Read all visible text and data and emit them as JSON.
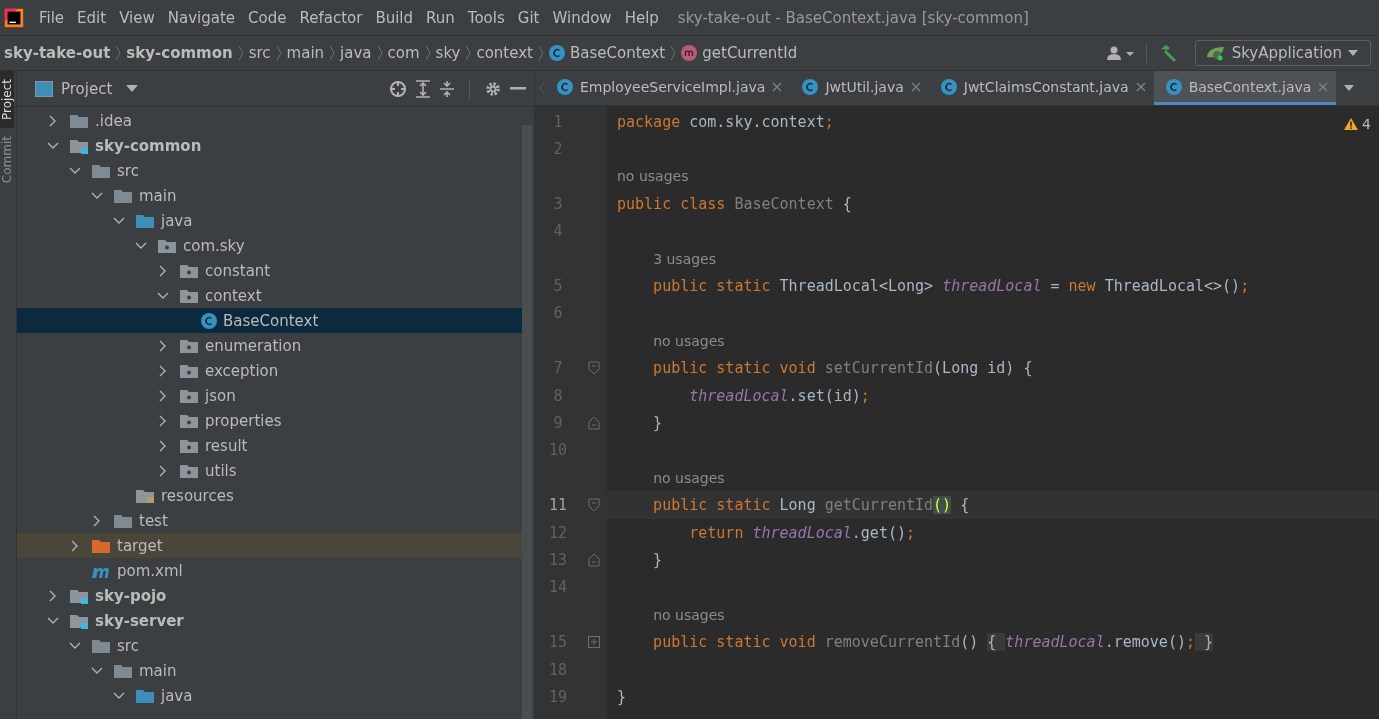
{
  "menu": [
    "File",
    "Edit",
    "View",
    "Navigate",
    "Code",
    "Refactor",
    "Build",
    "Run",
    "Tools",
    "Git",
    "Window",
    "Help"
  ],
  "window_title": "sky-take-out - BaseContext.java [sky-common]",
  "breadcrumbs": [
    {
      "text": "sky-take-out",
      "kind": "module"
    },
    {
      "text": "sky-common",
      "kind": "module"
    },
    {
      "text": "src",
      "kind": "folder"
    },
    {
      "text": "main",
      "kind": "folder"
    },
    {
      "text": "java",
      "kind": "folder"
    },
    {
      "text": "com",
      "kind": "folder"
    },
    {
      "text": "sky",
      "kind": "folder"
    },
    {
      "text": "context",
      "kind": "folder"
    },
    {
      "text": "BaseContext",
      "kind": "class"
    },
    {
      "text": "getCurrentId",
      "kind": "method"
    }
  ],
  "run_config": "SkyApplication",
  "side_tabs": [
    {
      "label": "Project",
      "selected": true
    },
    {
      "label": "Commit",
      "selected": false
    }
  ],
  "project_panel": {
    "title": "Project",
    "tree": [
      {
        "label": ".idea",
        "kind": "folder",
        "expanded": false,
        "selected": false
      },
      {
        "label": "sky-common",
        "kind": "module",
        "expanded": true,
        "selected": false,
        "children": [
          {
            "label": "src",
            "kind": "folder",
            "expanded": true,
            "selected": false,
            "children": [
              {
                "label": "main",
                "kind": "folder",
                "expanded": true,
                "selected": false,
                "children": [
                  {
                    "label": "java",
                    "kind": "source",
                    "expanded": true,
                    "selected": false,
                    "children": [
                      {
                        "label": "com.sky",
                        "kind": "package",
                        "expanded": true,
                        "selected": false,
                        "children": [
                          {
                            "label": "constant",
                            "kind": "package",
                            "expanded": false,
                            "selected": false
                          },
                          {
                            "label": "context",
                            "kind": "package",
                            "expanded": true,
                            "selected": false,
                            "children": [
                              {
                                "label": "BaseContext",
                                "kind": "class",
                                "selected": true
                              }
                            ]
                          },
                          {
                            "label": "enumeration",
                            "kind": "package",
                            "expanded": false,
                            "selected": false
                          },
                          {
                            "label": "exception",
                            "kind": "package",
                            "expanded": false,
                            "selected": false
                          },
                          {
                            "label": "json",
                            "kind": "package",
                            "expanded": false,
                            "selected": false
                          },
                          {
                            "label": "properties",
                            "kind": "package",
                            "expanded": false,
                            "selected": false
                          },
                          {
                            "label": "result",
                            "kind": "package",
                            "expanded": false,
                            "selected": false
                          },
                          {
                            "label": "utils",
                            "kind": "package",
                            "expanded": false,
                            "selected": false
                          }
                        ]
                      }
                    ]
                  },
                  {
                    "label": "resources",
                    "kind": "resources",
                    "selected": false
                  }
                ]
              },
              {
                "label": "test",
                "kind": "folder",
                "expanded": false,
                "selected": false
              }
            ]
          },
          {
            "label": "target",
            "kind": "excluded",
            "expanded": false,
            "selected": false
          },
          {
            "label": "pom.xml",
            "kind": "maven",
            "selected": false
          }
        ]
      },
      {
        "label": "sky-pojo",
        "kind": "module",
        "expanded": false,
        "selected": false
      },
      {
        "label": "sky-server",
        "kind": "module",
        "expanded": true,
        "selected": false,
        "children": [
          {
            "label": "src",
            "kind": "folder",
            "expanded": true,
            "selected": false,
            "children": [
              {
                "label": "main",
                "kind": "folder",
                "expanded": true,
                "selected": false,
                "children": [
                  {
                    "label": "java",
                    "kind": "source",
                    "expanded": true,
                    "selected": false
                  }
                ]
              }
            ]
          }
        ]
      }
    ]
  },
  "editor_tabs": [
    {
      "label": "EmployeeServiceImpl.java",
      "selected": false
    },
    {
      "label": "JwtUtil.java",
      "selected": false
    },
    {
      "label": "JwtClaimsConstant.java",
      "selected": false
    },
    {
      "label": "BaseContext.java",
      "selected": true
    }
  ],
  "warnings": "4",
  "lines": [
    {
      "kind": "code",
      "number": "1",
      "current": false,
      "tokens": [
        {
          "text": "package ",
          "kind": "keyword"
        },
        {
          "text": "com.sky.context",
          "kind": "plain"
        },
        {
          "text": ";",
          "kind": "keyword"
        }
      ]
    },
    {
      "kind": "code",
      "number": "2",
      "current": false
    },
    {
      "kind": "hint",
      "text": "no usages"
    },
    {
      "kind": "code",
      "number": "3",
      "current": false,
      "tokens": [
        {
          "text": "public class ",
          "kind": "keyword"
        },
        {
          "text": "BaseContext",
          "kind": "unused"
        },
        {
          "text": " {",
          "kind": "plain"
        }
      ]
    },
    {
      "kind": "code",
      "number": "4",
      "current": false
    },
    {
      "kind": "hint",
      "text": "    3 usages"
    },
    {
      "kind": "code",
      "number": "5",
      "current": false,
      "tokens": [
        {
          "text": "    public static ",
          "kind": "keyword"
        },
        {
          "text": "ThreadLocal<Long> ",
          "kind": "plain"
        },
        {
          "text": "threadLocal",
          "kind": "field"
        },
        {
          "text": " = ",
          "kind": "plain"
        },
        {
          "text": "new ",
          "kind": "keyword"
        },
        {
          "text": "ThreadLocal<>()",
          "kind": "plain"
        },
        {
          "text": ";",
          "kind": "keyword"
        }
      ]
    },
    {
      "kind": "code",
      "number": "6",
      "current": false
    },
    {
      "kind": "hint",
      "text": "    no usages"
    },
    {
      "kind": "code",
      "number": "7",
      "current": false,
      "fold_start": true,
      "tokens": [
        {
          "text": "    public static void ",
          "kind": "keyword"
        },
        {
          "text": "setCurrentId",
          "kind": "unused"
        },
        {
          "text": "(Long id) {",
          "kind": "plain"
        }
      ]
    },
    {
      "kind": "code",
      "number": "8",
      "current": false,
      "tokens": [
        {
          "text": "        threadLocal",
          "kind": "field"
        },
        {
          "text": ".set(id)",
          "kind": "plain"
        },
        {
          "text": ";",
          "kind": "keyword"
        }
      ]
    },
    {
      "kind": "code",
      "number": "9",
      "current": false,
      "fold_end": true,
      "tokens": [
        {
          "text": "    }",
          "kind": "plain"
        }
      ]
    },
    {
      "kind": "code",
      "number": "10",
      "current": false
    },
    {
      "kind": "hint",
      "text": "    no usages"
    },
    {
      "kind": "code",
      "number": "11",
      "current": true,
      "fold_start": true,
      "tokens": [
        {
          "text": "    public static ",
          "kind": "keyword"
        },
        {
          "text": "Long ",
          "kind": "plain"
        },
        {
          "text": "getCurrentId",
          "kind": "unused"
        },
        {
          "text": "()",
          "kind": "match"
        },
        {
          "text": " {",
          "kind": "plain"
        }
      ]
    },
    {
      "kind": "code",
      "number": "12",
      "current": false,
      "tokens": [
        {
          "text": "        return ",
          "kind": "keyword"
        },
        {
          "text": "threadLocal",
          "kind": "field"
        },
        {
          "text": ".get()",
          "kind": "plain"
        },
        {
          "text": ";",
          "kind": "keyword"
        }
      ]
    },
    {
      "kind": "code",
      "number": "13",
      "current": false,
      "fold_end": true,
      "tokens": [
        {
          "text": "    }",
          "kind": "plain"
        }
      ]
    },
    {
      "kind": "code",
      "number": "14",
      "current": false
    },
    {
      "kind": "hint",
      "text": "    no usages"
    },
    {
      "kind": "code",
      "number": "15",
      "current": false,
      "folded": true,
      "tokens": [
        {
          "text": "    public static void ",
          "kind": "keyword"
        },
        {
          "text": "removeCurrentId",
          "kind": "unused"
        },
        {
          "text": "() ",
          "kind": "plain"
        },
        {
          "text": "{ ",
          "kind": "folded"
        },
        {
          "text": "threadLocal",
          "kind": "field"
        },
        {
          "text": ".remove()",
          "kind": "plain"
        },
        {
          "text": ";",
          "kind": "keyword"
        },
        {
          "text": " }",
          "kind": "folded"
        }
      ]
    },
    {
      "kind": "code",
      "number": "18",
      "current": false
    },
    {
      "kind": "code",
      "number": "19",
      "current": false,
      "tokens": [
        {
          "text": "}",
          "kind": "plain"
        }
      ]
    }
  ]
}
